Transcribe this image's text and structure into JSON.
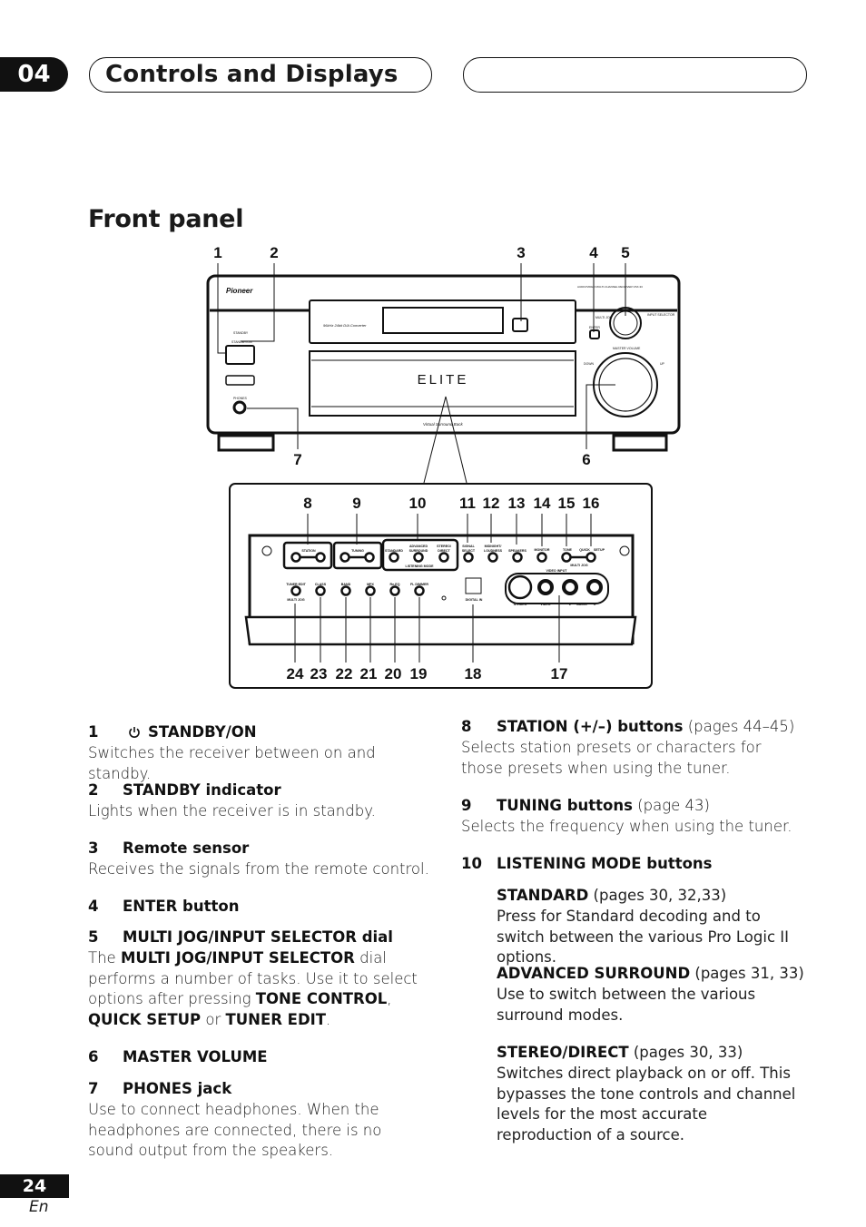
{
  "header": {
    "chapter": "04",
    "title": "Controls and Displays"
  },
  "section_title": "Front panel",
  "diagram": {
    "callouts_top": [
      "1",
      "2",
      "3",
      "4",
      "5"
    ],
    "callouts_side": [
      "7",
      "6"
    ],
    "callouts_inset_top": [
      "8",
      "9",
      "10",
      "11",
      "12",
      "13",
      "14",
      "15",
      "16"
    ],
    "callouts_inset_bottom": [
      "24",
      "23",
      "22",
      "21",
      "20",
      "19",
      "18",
      "17"
    ],
    "receiver": {
      "brand": "Pioneer",
      "model_text": "AUDIO/VIDEO MULTI-CHANNEL RECEIVER VSX-33",
      "dac_text": "96kHz 24bit D/A Converter",
      "elite": "ELITE",
      "standby": "STANDBY",
      "standby_on": "STANDBY/ON",
      "phones": "PHONES",
      "input_selector": "INPUT SELECTOR",
      "multi_jog": "MULTI JOG",
      "enter": "ENTER",
      "master_volume": "MASTER VOLUME",
      "down": "DOWN",
      "up": "UP",
      "virtual_back": "Virtual Surround Back"
    },
    "panel": {
      "station": "STATION",
      "tuning": "TUNING",
      "minus": "–",
      "plus": "+",
      "standard": "STANDARD",
      "advanced": "ADVANCED",
      "surround": "SURROUND",
      "stereo": "STEREO/",
      "direct": "DIRECT",
      "listening_mode": "LISTENING MODE",
      "signal": "SIGNAL",
      "select": "SELECT",
      "midnight": "MIDNIGHT/",
      "loudness": "LOUDNESS",
      "speakers": "SPEAKERS",
      "monitor": "MONITOR",
      "tone": "TONE",
      "quick": "QUICK",
      "setup": "SETUP",
      "multi_jog": "MULTI JOG",
      "tuner_edit": "TUNER EDIT",
      "class": "CLASS",
      "band": "BAND",
      "mpx": "MPX",
      "reeq": "Re-EQ",
      "fl_dimmer": "FL DIMMER",
      "digital_in": "DIGITAL IN",
      "video_input": "VIDEO INPUT",
      "svideo": "S-VIDEO",
      "video": "VIDEO",
      "l": "L",
      "audio": "AUDIO",
      "r": "R"
    }
  },
  "left_items": [
    {
      "num": "1",
      "heading": "STANDBY/ON",
      "icon": "power-icon",
      "desc": "Switches the receiver between on and standby."
    },
    {
      "num": "2",
      "heading": "STANDBY indicator",
      "desc": "Lights when the receiver is in standby."
    },
    {
      "num": "3",
      "heading": "Remote sensor",
      "desc": "Receives the signals from the remote control."
    },
    {
      "num": "4",
      "heading": "ENTER button"
    },
    {
      "num": "5",
      "heading": "MULTI JOG/INPUT SELECTOR dial",
      "desc_parts": [
        "The ",
        "MULTI JOG/INPUT SELECTOR",
        " dial performs a number of tasks. Use it to select options after pressing ",
        "TONE CONTROL",
        ", ",
        "QUICK SETUP",
        " or ",
        "TUNER EDIT",
        "."
      ]
    },
    {
      "num": "6",
      "heading": "MASTER VOLUME"
    },
    {
      "num": "7",
      "heading": "PHONES jack",
      "desc": "Use to connect headphones. When the headphones are connected, there is no sound output from the speakers."
    }
  ],
  "right_items": [
    {
      "num": "8",
      "heading": "STATION (+/–) buttons",
      "pages": " (pages 44–45)",
      "desc": "Selects station presets or characters for those presets when using the tuner."
    },
    {
      "num": "9",
      "heading": "TUNING buttons",
      "pages": " (page 43)",
      "desc": "Selects the frequency when using the tuner."
    },
    {
      "num": "10",
      "heading": "LISTENING MODE buttons",
      "subs": [
        {
          "heading": "STANDARD",
          "pages": " (pages 30, 32,33)",
          "desc": "Press for Standard decoding and to switch between the various Pro Logic II options."
        },
        {
          "heading": "ADVANCED SURROUND",
          "pages": " (pages 31, 33)",
          "desc": "Use to switch between the various surround modes."
        },
        {
          "heading": "STEREO/DIRECT",
          "pages": " (pages 30, 33)",
          "desc": "Switches direct playback on or off. This bypasses the tone controls and channel levels for the most accurate reproduction of a source."
        }
      ]
    }
  ],
  "footer": {
    "page": "24",
    "lang": "En"
  }
}
